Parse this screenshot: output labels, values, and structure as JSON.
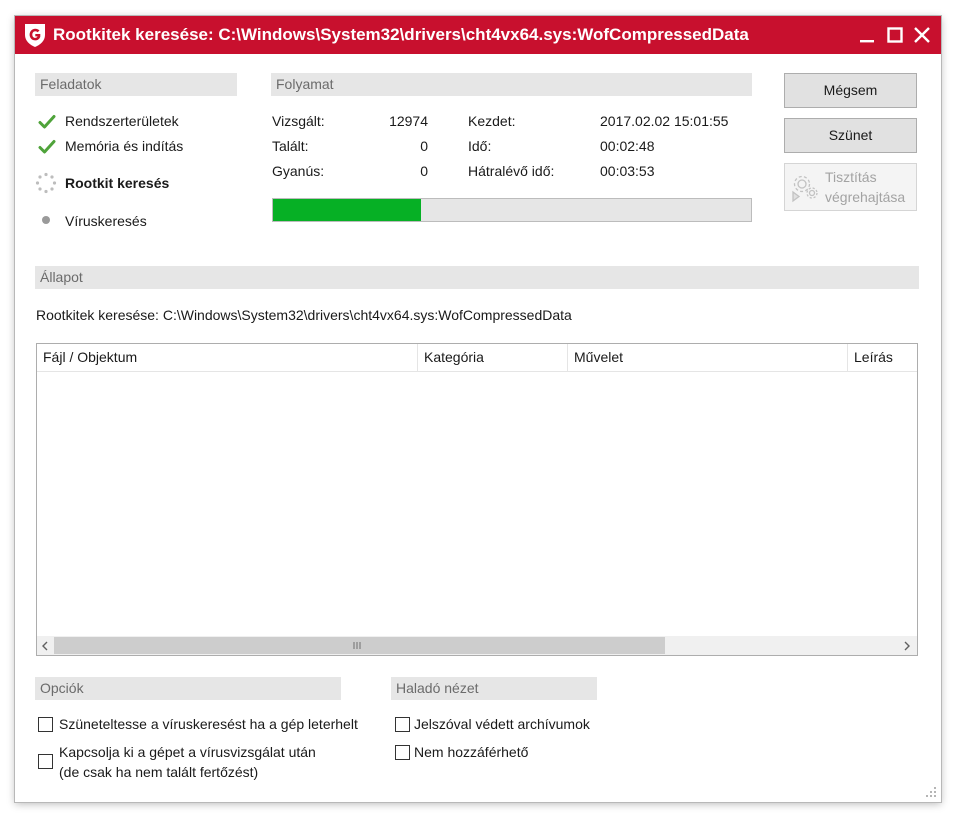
{
  "window": {
    "title": "Rootkitek keresése: C:\\Windows\\System32\\drivers\\cht4vx64.sys:WofCompressedData",
    "brand_color": "#c8102e"
  },
  "tasks": {
    "header": "Feladatok",
    "items": [
      {
        "label": "Rendszerterületek",
        "state": "done",
        "icon": "check-icon"
      },
      {
        "label": "Memória és indítás",
        "state": "done",
        "icon": "check-icon"
      },
      {
        "label": "Rootkit keresés",
        "state": "active",
        "icon": "spinner-icon"
      },
      {
        "label": "Víruskeresés",
        "state": "pending",
        "icon": "dot-icon"
      }
    ]
  },
  "progress": {
    "header": "Folyamat",
    "scanned_label": "Vizsgált:",
    "scanned_value": "12974",
    "found_label": "Talált:",
    "found_value": "0",
    "suspicious_label": "Gyanús:",
    "suspicious_value": "0",
    "start_label": "Kezdet:",
    "start_value": "2017.02.02 15:01:55",
    "time_label": "Idő:",
    "time_value": "00:02:48",
    "remaining_label": "Hátralévő idő:",
    "remaining_value": "00:03:53",
    "bar_fraction": 0.31,
    "bar_color": "#06b025"
  },
  "buttons": {
    "cancel": "Mégsem",
    "pause": "Szünet",
    "clean_line1": "Tisztítás",
    "clean_line2": "végrehajtása"
  },
  "status": {
    "header": "Állapot",
    "text": "Rootkitek keresése: C:\\Windows\\System32\\drivers\\cht4vx64.sys:WofCompressedData"
  },
  "results_table": {
    "columns": [
      "Fájl / Objektum",
      "Kategória",
      "Művelet",
      "Leírás"
    ],
    "rows": []
  },
  "options": {
    "header": "Opciók",
    "pause_on_load": {
      "label": "Szüneteltesse a víruskeresést ha a gép leterhelt",
      "checked": false
    },
    "shutdown_line1": "Kapcsolja ki a gépet a vírusvizsgálat után",
    "shutdown_line2": "(de csak ha nem talált fertőzést)",
    "shutdown_checked": false
  },
  "advanced": {
    "header": "Haladó nézet",
    "password_archives": {
      "label": "Jelszóval védett archívumok",
      "checked": false
    },
    "inaccessible": {
      "label": "Nem hozzáférhető",
      "checked": false
    }
  }
}
